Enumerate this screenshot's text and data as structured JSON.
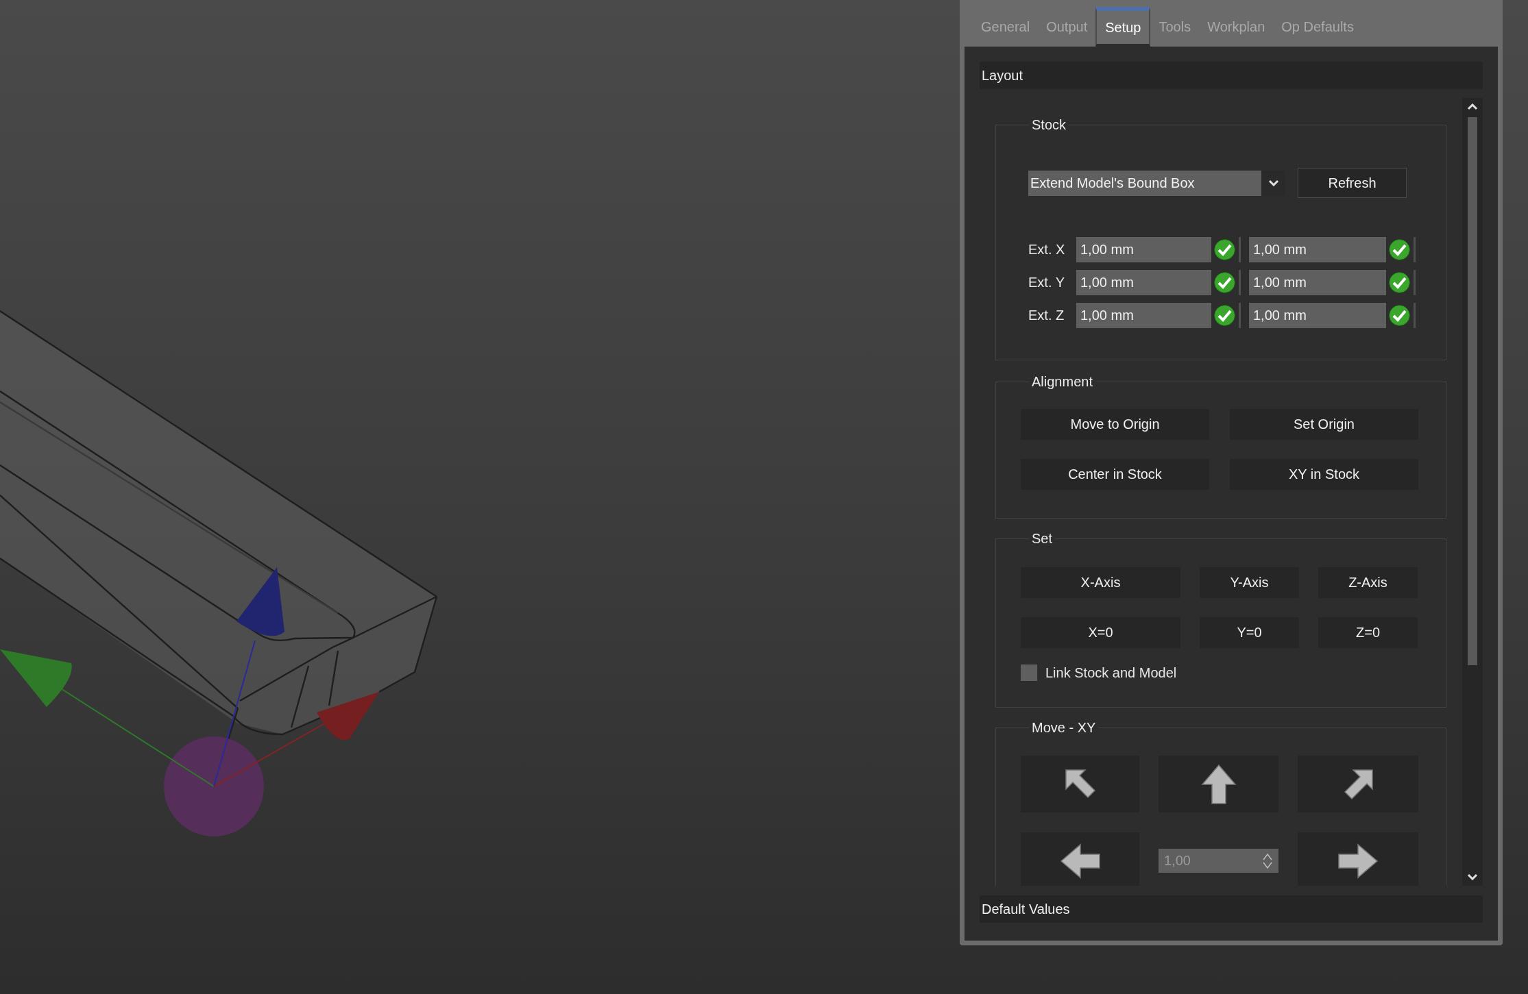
{
  "tabs": [
    {
      "label": "General",
      "selected": false
    },
    {
      "label": "Output",
      "selected": false
    },
    {
      "label": "Setup",
      "selected": true
    },
    {
      "label": "Tools",
      "selected": false
    },
    {
      "label": "Workplan",
      "selected": false
    },
    {
      "label": "Op Defaults",
      "selected": false
    }
  ],
  "layout_header": "Layout",
  "stock": {
    "title": "Stock",
    "mode": "Extend Model's Bound Box",
    "refresh": "Refresh",
    "extents": [
      {
        "label": "Ext. X",
        "min": "1,00 mm",
        "max": "1,00 mm",
        "min_valid": true,
        "max_valid": true
      },
      {
        "label": "Ext. Y",
        "min": "1,00 mm",
        "max": "1,00 mm",
        "min_valid": true,
        "max_valid": true
      },
      {
        "label": "Ext. Z",
        "min": "1,00 mm",
        "max": "1,00 mm",
        "min_valid": true,
        "max_valid": true
      }
    ]
  },
  "alignment": {
    "title": "Alignment",
    "buttons": [
      "Move to Origin",
      "Set Origin",
      "Center in Stock",
      "XY in Stock"
    ]
  },
  "set": {
    "title": "Set",
    "buttons": [
      "X-Axis",
      "Y-Axis",
      "Z-Axis",
      "X=0",
      "Y=0",
      "Z=0"
    ],
    "link": {
      "label": "Link Stock and Model",
      "checked": false
    }
  },
  "move_xy": {
    "title": "Move - XY",
    "step": {
      "value": "1,00",
      "disabled": true
    }
  },
  "default_header": "Default Values"
}
